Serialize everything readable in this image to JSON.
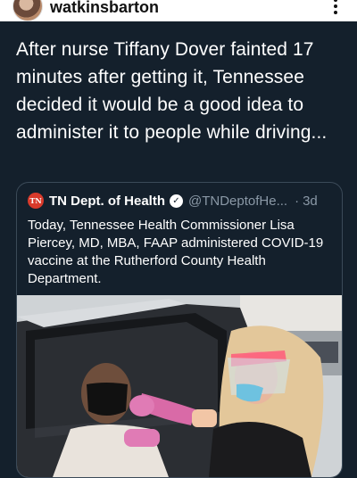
{
  "header": {
    "username": "watkinsbarton"
  },
  "post": {
    "text": "After nurse Tiffany Dover fainted 17 minutes after getting it, Tennessee decided it would be a good idea to administer it to people while driving..."
  },
  "quote": {
    "logo_text": "TN",
    "name": "TN Dept. of Health",
    "handle": "@TNDeptofHe...",
    "separator": "·",
    "time": "3d",
    "text": "Today, Tennessee Health Commissioner Lisa Piercey, MD, MBA, FAAP administered COVID-19 vaccine at the Rutherford County Health Department."
  },
  "colors": {
    "background": "#14202c",
    "border": "#3b4a58",
    "secondary_text": "#8a98a6"
  }
}
